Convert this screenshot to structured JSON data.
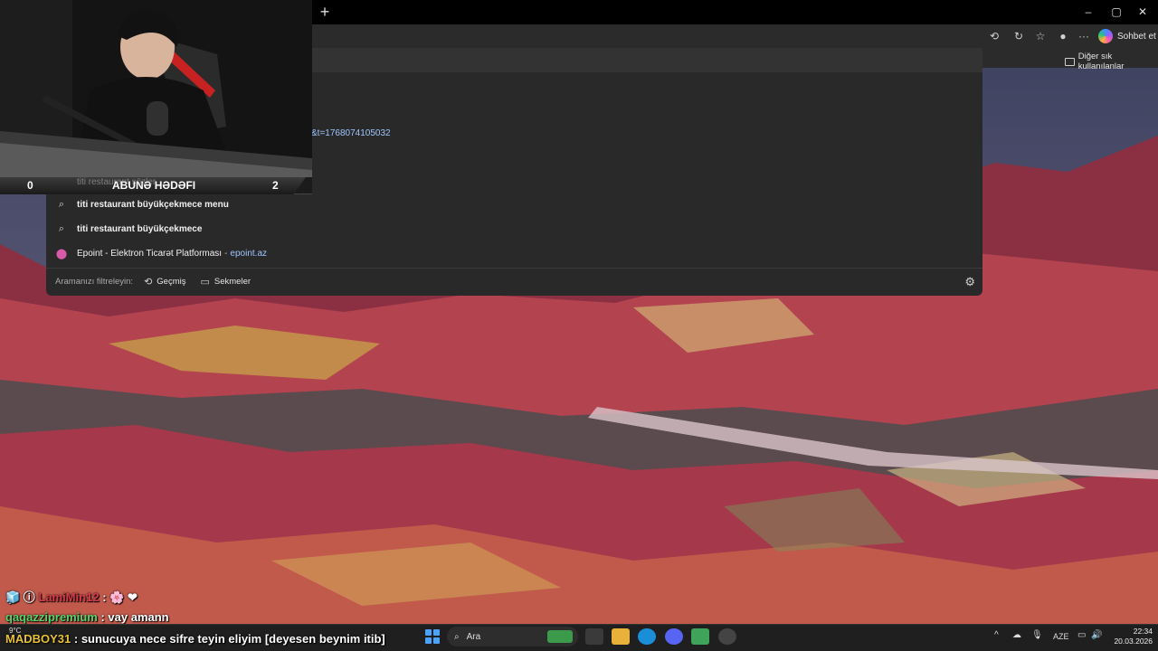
{
  "browser": {
    "new_tab_glyph": "+",
    "window_controls": {
      "minimize": "–",
      "maximize": "▢",
      "close": "✕"
    },
    "toolbar_icons": [
      "extensions-icon",
      "reading-view-icon",
      "favorites-icon",
      "profile-badge-icon",
      "more-icon"
    ],
    "toolbar_glyphs": {
      "extensions": "⟲",
      "reading": "↻",
      "favorites": "☆",
      "badge": "●",
      "more": "···"
    },
    "copilot_label": "Sohbet et",
    "favorites_other_label": "Diğer sık kullanılanlar"
  },
  "dropdown": {
    "url_fragment": "&t=1768074105032",
    "ghost_suggestion": "titi restaurant sözler",
    "suggestions": [
      {
        "icon": "search-icon",
        "text": "titi restaurant büyükçekmece menu"
      },
      {
        "icon": "search-icon",
        "text": "titi restaurant büyükçekmece"
      }
    ],
    "site_suggestion": {
      "icon": "pin-icon",
      "title": "Epoint - Elektron Ticarət Platforması",
      "separator": "-",
      "domain": "epoint.az"
    },
    "filter": {
      "label": "Aramanızı filtreleyin:",
      "history_label": "Geçmiş",
      "tabs_label": "Sekmeler"
    },
    "glyphs": {
      "search": "⌕",
      "pin": "⬤",
      "history": "⟲",
      "tabs": "▭",
      "gear": "⚙"
    }
  },
  "overlay": {
    "sub_goal": {
      "current": "0",
      "label": "ABUNƏ HƏDƏFI",
      "target": "2"
    }
  },
  "chat": [
    {
      "user": "LamiMin12",
      "user_color": "#d63a4a",
      "badges": "🧊 ⓘ",
      "message": "🌸 ❤"
    },
    {
      "user": "qaqazzipremium",
      "user_color": "#5ad36a",
      "badges": "",
      "message": "vay amann"
    },
    {
      "user": "MADBOY31",
      "user_color": "#e8c23a",
      "badges": "",
      "message": "sunucuya nece sifre teyin eliyim [deyesen beynim itib]"
    }
  ],
  "taskbar": {
    "weather": "9°C",
    "search_placeholder": "Ara",
    "search_glyph": "⌕",
    "lang": "AZE",
    "time": "22:34",
    "date": "20.03.2026",
    "tray_glyphs": {
      "chevron": "^",
      "cloud": "☁",
      "mic": "🎙",
      "network": "▭",
      "volume": "🔊",
      "battery": "▮"
    },
    "apps": [
      "task-view-icon",
      "file-explorer-icon",
      "edge-icon",
      "discord-icon",
      "app-cube-icon",
      "obs-icon"
    ]
  },
  "colors": {
    "accent": "#4aa3ff",
    "link": "#9ec5ff",
    "panel": "#292929"
  }
}
